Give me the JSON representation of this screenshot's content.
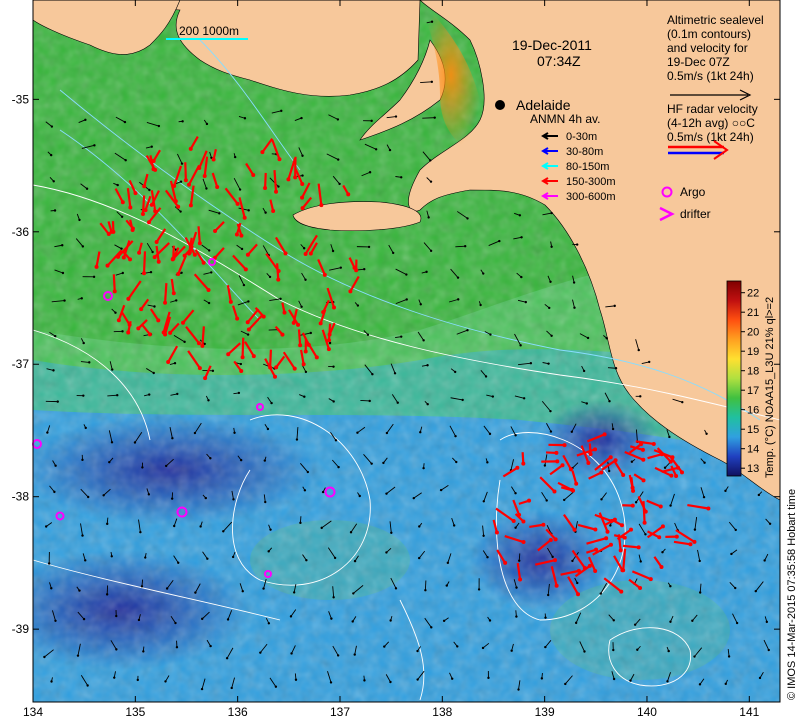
{
  "map": {
    "date": "19-Dec-2011",
    "time": "07:34Z",
    "city": "Adelaide",
    "scale_bar": "200  1000m",
    "lon_ticks": [
      "134",
      "135",
      "136",
      "137",
      "138",
      "139",
      "140",
      "141"
    ],
    "lat_ticks": [
      "-35",
      "-36",
      "-37",
      "-38",
      "-39"
    ],
    "lon_values": [
      134,
      135,
      136,
      137,
      138,
      139,
      140,
      141
    ],
    "lat_values": [
      -35,
      -36,
      -37,
      -38,
      -39
    ],
    "lon_range": [
      134,
      141.3
    ],
    "lat_range": [
      -39.55,
      -34.25
    ]
  },
  "altimetry_legend": {
    "line1": "Altimetric sealevel",
    "line2": "(0.1m contours)",
    "line3": "and velocity for",
    "line4": "19-Dec 07Z",
    "line5": "0.5m/s (1kt 24h)"
  },
  "hf_legend": {
    "line1": "HF radar velocity",
    "line2": "(4-12h avg) ○○C",
    "line3": "0.5m/s (1kt 24h)",
    "colors": [
      "#ff0000",
      "#0000ff"
    ]
  },
  "anmn_legend": {
    "title": "ANMN 4h av.",
    "items": [
      {
        "label": "0-30m",
        "color": "#000000"
      },
      {
        "label": "30-80m",
        "color": "#0000ff"
      },
      {
        "label": "80-150m",
        "color": "#00ffff"
      },
      {
        "label": "150-300m",
        "color": "#ff0000"
      },
      {
        "label": "300-600m",
        "color": "#ff00ff"
      }
    ]
  },
  "markers_legend": {
    "argo": "Argo",
    "drifter": "drifter",
    "color": "#ff00ff"
  },
  "colorbar": {
    "ticks": [
      "22",
      "21",
      "20",
      "19",
      "18",
      "17",
      "16",
      "15",
      "14",
      "13"
    ],
    "values": [
      22,
      21,
      20,
      19,
      18,
      17,
      16,
      15,
      14,
      13
    ],
    "label": "Temp. (°C) NOAA15_L3U 21% ql>=2"
  },
  "credit": "© IMOS 14-Mar-2015 07:35:58 Hobart time",
  "colors": {
    "land": "#f7c89b",
    "coast_green": "#2eb82e",
    "cool_blue": "#3aa0e0",
    "deep_blue": "#1a2a9a",
    "hf_arrow": "#ff0000",
    "current_arrow": "#000000",
    "argo": "#ff00ff"
  }
}
